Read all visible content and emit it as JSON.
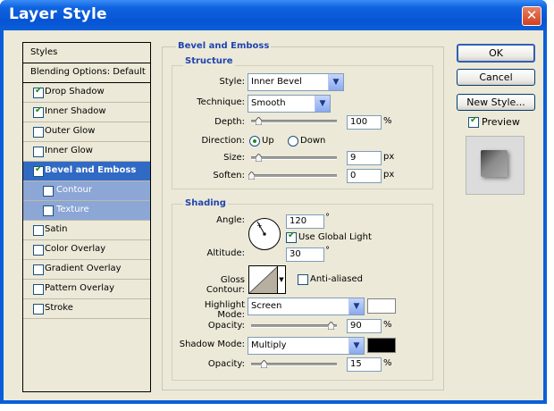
{
  "window": {
    "title": "Layer Style"
  },
  "styles_list": {
    "header": "Styles",
    "blending": "Blending Options: Default",
    "items": [
      {
        "label": "Drop Shadow",
        "checked": true
      },
      {
        "label": "Inner Shadow",
        "checked": true
      },
      {
        "label": "Outer Glow",
        "checked": false
      },
      {
        "label": "Inner Glow",
        "checked": false
      },
      {
        "label": "Bevel and Emboss",
        "checked": true,
        "selected": true
      },
      {
        "label": "Contour",
        "checked": false,
        "sub": true
      },
      {
        "label": "Texture",
        "checked": false,
        "sub": true
      },
      {
        "label": "Satin",
        "checked": false
      },
      {
        "label": "Color Overlay",
        "checked": false
      },
      {
        "label": "Gradient Overlay",
        "checked": false
      },
      {
        "label": "Pattern Overlay",
        "checked": false
      },
      {
        "label": "Stroke",
        "checked": false
      }
    ]
  },
  "bevel": {
    "group_title": "Bevel and Emboss",
    "structure_title": "Structure",
    "style_label": "Style:",
    "style_value": "Inner Bevel",
    "technique_label": "Technique:",
    "technique_value": "Smooth",
    "depth_label": "Depth:",
    "depth_value": "100",
    "depth_unit": "%",
    "direction_label": "Direction:",
    "direction_up": "Up",
    "direction_down": "Down",
    "size_label": "Size:",
    "size_value": "9",
    "size_unit": "px",
    "soften_label": "Soften:",
    "soften_value": "0",
    "soften_unit": "px"
  },
  "shading": {
    "title": "Shading",
    "angle_label": "Angle:",
    "angle_value": "120",
    "angle_unit": "°",
    "use_global_light": "Use Global Light",
    "altitude_label": "Altitude:",
    "altitude_value": "30",
    "altitude_unit": "°",
    "gloss_label": "Gloss Contour:",
    "anti_aliased": "Anti-aliased",
    "highlight_label": "Highlight Mode:",
    "highlight_value": "Screen",
    "highlight_color": "#ffffff",
    "opacity_label": "Opacity:",
    "highlight_opacity": "90",
    "opacity_unit": "%",
    "shadow_label": "Shadow Mode:",
    "shadow_value": "Multiply",
    "shadow_color": "#000000",
    "shadow_opacity": "15"
  },
  "buttons": {
    "ok": "OK",
    "cancel": "Cancel",
    "new_style": "New Style...",
    "preview": "Preview"
  }
}
